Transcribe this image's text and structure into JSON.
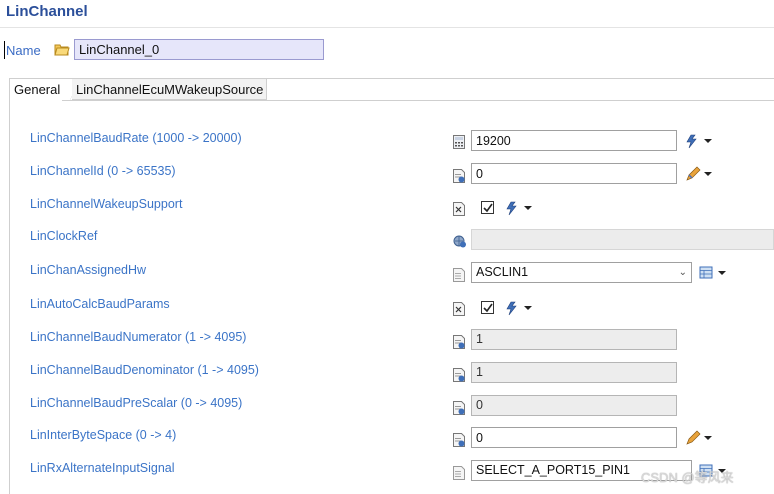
{
  "window": {
    "title": "LinChannel"
  },
  "name_field": {
    "label": "Name",
    "value": "LinChannel_0"
  },
  "tabs": [
    {
      "label": "General",
      "active": true
    },
    {
      "label": "LinChannelEcuMWakeupSource",
      "active": false
    }
  ],
  "params": [
    {
      "label": "LinChannelBaudRate (1000 -> 20000)",
      "value": "19200",
      "control": "text"
    },
    {
      "label": "LinChannelId (0 -> 65535)",
      "value": "0",
      "control": "text"
    },
    {
      "label": "LinChannelWakeupSupport",
      "checked": true,
      "control": "checkbox"
    },
    {
      "label": "LinClockRef",
      "value": "",
      "control": "reference"
    },
    {
      "label": "LinChanAssignedHw",
      "value": "ASCLIN1",
      "control": "select"
    },
    {
      "label": "LinAutoCalcBaudParams",
      "checked": true,
      "control": "checkbox"
    },
    {
      "label": "LinChannelBaudNumerator (1 -> 4095)",
      "value": "1",
      "control": "text-disabled"
    },
    {
      "label": "LinChannelBaudDenominator (1 -> 4095)",
      "value": "1",
      "control": "text-disabled"
    },
    {
      "label": "LinChannelBaudPreScalar (0 -> 4095)",
      "value": "0",
      "control": "text-disabled"
    },
    {
      "label": "LinInterByteSpace (0 -> 4)",
      "value": "0",
      "control": "text"
    },
    {
      "label": "LinRxAlternateInputSignal",
      "value": "SELECT_A_PORT15_PIN1",
      "control": "select"
    }
  ],
  "watermark": "CSDN @等风来",
  "icons": {
    "folder": "folder-icon",
    "calc": "calculator-icon",
    "param": "parameter-icon",
    "bool": "boolean-icon",
    "ref": "reference-icon",
    "lightning": "lightning-icon",
    "pencil": "pencil-icon",
    "table": "table-icon",
    "dropdown": "dropdown-arrow-icon"
  },
  "colors": {
    "title": "#2b4f9a",
    "label": "#3b74c7",
    "name_bg": "#e6e6fa"
  }
}
